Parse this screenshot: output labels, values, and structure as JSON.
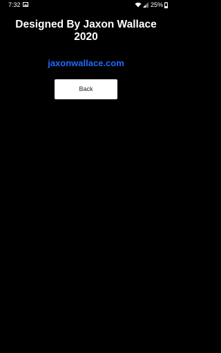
{
  "status_bar": {
    "time": "7:32",
    "battery": "25%",
    "icons": [
      "image-icon",
      "wifi-icon",
      "signal-icon",
      "battery-icon"
    ]
  },
  "title": {
    "line1": "Designed By Jaxon Wallace",
    "line2": "2020"
  },
  "link": {
    "text": "jaxonwallace.com",
    "color": "#1e6bff"
  },
  "back_button": {
    "label": "Back"
  },
  "colors": {
    "background": "#000000",
    "text": "#ffffff",
    "button_bg": "#ffffff"
  }
}
